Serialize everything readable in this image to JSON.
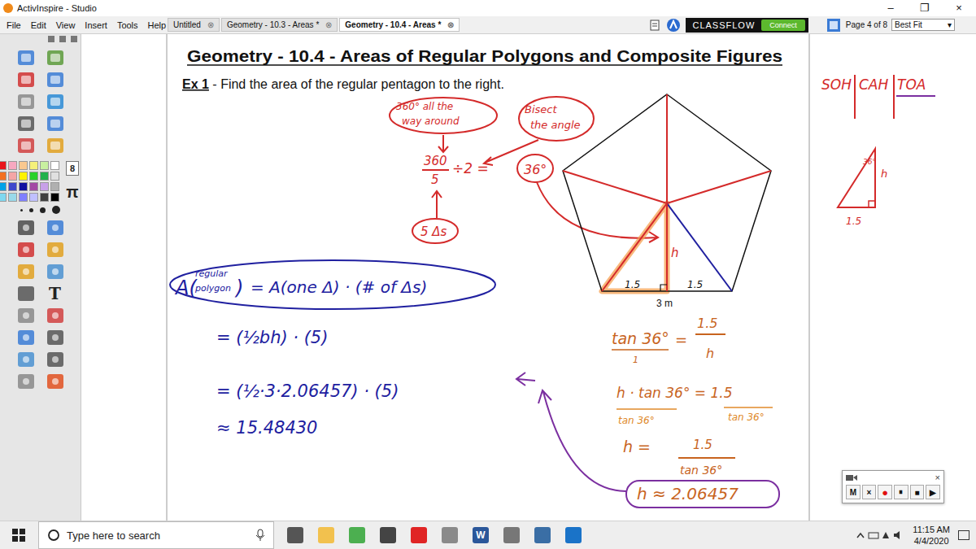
{
  "window": {
    "title": "ActivInspire - Studio",
    "controls": [
      "–",
      "❐",
      "×"
    ]
  },
  "menu": [
    "File",
    "Edit",
    "View",
    "Insert",
    "Tools",
    "Help"
  ],
  "tabs": [
    {
      "label": "Untitled",
      "close": "⊗",
      "selected": false
    },
    {
      "label": "Geometry - 10.3 - Areas *",
      "close": "⊗",
      "selected": false
    },
    {
      "label": "Geometry - 10.4 - Areas *",
      "close": "⊗",
      "selected": true
    }
  ],
  "classflow": {
    "label": "CLASSFLOW",
    "button": "Connect"
  },
  "page": {
    "indicator": "Page 4 of 8",
    "zoom": "Best Fit",
    "zoom_arrow": "▾"
  },
  "toolbox": {
    "glyphs": [
      "8",
      "π",
      "T"
    ],
    "palette": [
      "#e8141b",
      "#f7a8c0",
      "#f9c890",
      "#f5f07a",
      "#c8f0a0",
      "#ffffff",
      "#f37021",
      "#f4a5a5",
      "#fff200",
      "#2ad12a",
      "#22b14c",
      "#e0e0e0",
      "#00a2e8",
      "#3f48cc",
      "#1010a0",
      "#a349a4",
      "#c8a0e8",
      "#b0b0b0",
      "#7fd8f0",
      "#99d9ea",
      "#8080ff",
      "#c0c0ff",
      "#404040",
      "#000000"
    ]
  },
  "document": {
    "title": "Geometry - 10.4 - Areas of Regular Polygons and Composite Figures",
    "example_label": "Ex 1",
    "example_text": " - Find the area of the regular pentagon to the right."
  },
  "annotations": [
    {
      "text": "360° all the",
      "color": "#d42a2a",
      "kind": "ink"
    },
    {
      "text": "way around",
      "color": "#d42a2a",
      "kind": "ink"
    },
    {
      "text": "Bisect",
      "color": "#d42a2a",
      "kind": "ink"
    },
    {
      "text": "the angle",
      "color": "#d42a2a",
      "kind": "ink"
    },
    {
      "text": "360",
      "color": "#d42a2a",
      "kind": "ink"
    },
    {
      "text": "5",
      "color": "#d42a2a",
      "kind": "ink"
    },
    {
      "text": "÷2 =",
      "color": "#d42a2a",
      "kind": "ink"
    },
    {
      "text": "36°",
      "color": "#d42a2a",
      "kind": "ink"
    },
    {
      "text": "5 Δs",
      "color": "#d42a2a",
      "kind": "ink"
    },
    {
      "text": "SOH",
      "color": "#d42a2a",
      "kind": "ink"
    },
    {
      "text": "CAH",
      "color": "#d42a2a",
      "kind": "ink"
    },
    {
      "text": "TOA",
      "color": "#d42a2a",
      "kind": "ink"
    },
    {
      "text": "36°",
      "color": "#d42a2a",
      "kind": "ink"
    },
    {
      "text": "h",
      "color": "#d42a2a",
      "kind": "ink"
    },
    {
      "text": "1.5",
      "color": "#d42a2a",
      "kind": "ink"
    },
    {
      "text": "h",
      "color": "#d42a2a",
      "kind": "ink"
    },
    {
      "text": "1.5",
      "color": "#111111",
      "kind": "ink"
    },
    {
      "text": "1.5",
      "color": "#111111",
      "kind": "ink"
    },
    {
      "text": "3 m",
      "color": "#111111",
      "kind": "typed"
    },
    {
      "text": "A(",
      "color": "#2020a0",
      "kind": "ink"
    },
    {
      "text": "regular",
      "color": "#2020a0",
      "kind": "ink"
    },
    {
      "text": "polygon",
      "color": "#2020a0",
      "kind": "ink"
    },
    {
      "text": ")",
      "color": "#2020a0",
      "kind": "ink"
    },
    {
      "text": "= A(one Δ) · (# of Δs)",
      "color": "#2020a0",
      "kind": "ink"
    },
    {
      "text": "= (½bh) · (5)",
      "color": "#2020a0",
      "kind": "ink"
    },
    {
      "text": "= (½·3·2.06457) · (5)",
      "color": "#2020a0",
      "kind": "ink"
    },
    {
      "text": "≈ 15.48430",
      "color": "#2020a0",
      "kind": "ink"
    },
    {
      "text": "tan 36°",
      "color": "#c8641e",
      "kind": "ink"
    },
    {
      "text": "1.5",
      "color": "#c8641e",
      "kind": "ink"
    },
    {
      "text": "h",
      "color": "#c8641e",
      "kind": "ink"
    },
    {
      "text": "h · tan 36° = 1.5",
      "color": "#c8641e",
      "kind": "ink"
    },
    {
      "text": "tan 36°",
      "color": "#e08a2a",
      "kind": "ink"
    },
    {
      "text": "tan 36°",
      "color": "#e08a2a",
      "kind": "ink"
    },
    {
      "text": "h =",
      "color": "#c8641e",
      "kind": "ink"
    },
    {
      "text": "1.5",
      "color": "#c8641e",
      "kind": "ink"
    },
    {
      "text": "tan 36°",
      "color": "#c8641e",
      "kind": "ink"
    },
    {
      "text": "h ≈ 2.06457",
      "color": "#c8641e",
      "kind": "ink"
    },
    {
      "text": "1",
      "color": "#c8641e",
      "kind": "ink"
    },
    {
      "text": "=",
      "color": "#c8641e",
      "kind": "ink"
    }
  ],
  "recorder": {
    "close": "×",
    "buttons": [
      {
        "label": "M",
        "recording": false
      },
      {
        "label": "×",
        "recording": false
      },
      {
        "label": "●",
        "recording": true
      },
      {
        "label": "⏸",
        "recording": false
      },
      {
        "label": "■",
        "recording": false
      },
      {
        "label": "▶",
        "recording": false
      }
    ]
  },
  "taskbar": {
    "search_placeholder": "Type here to search",
    "time": "11:15 AM",
    "date": "4/4/2020",
    "apps": [
      {
        "glyph": "",
        "color": "#555555"
      },
      {
        "glyph": "",
        "color": "#f2c14e"
      },
      {
        "glyph": "",
        "color": "#4caf50"
      },
      {
        "glyph": "",
        "color": "#444444"
      },
      {
        "glyph": "",
        "color": "#e02424"
      },
      {
        "glyph": "",
        "color": "#8a8a8a"
      },
      {
        "glyph": "W",
        "color": "#2b579a"
      },
      {
        "glyph": "",
        "color": "#777777"
      },
      {
        "glyph": "",
        "color": "#3a6ea5"
      },
      {
        "glyph": "",
        "color": "#1a73c8"
      }
    ]
  }
}
